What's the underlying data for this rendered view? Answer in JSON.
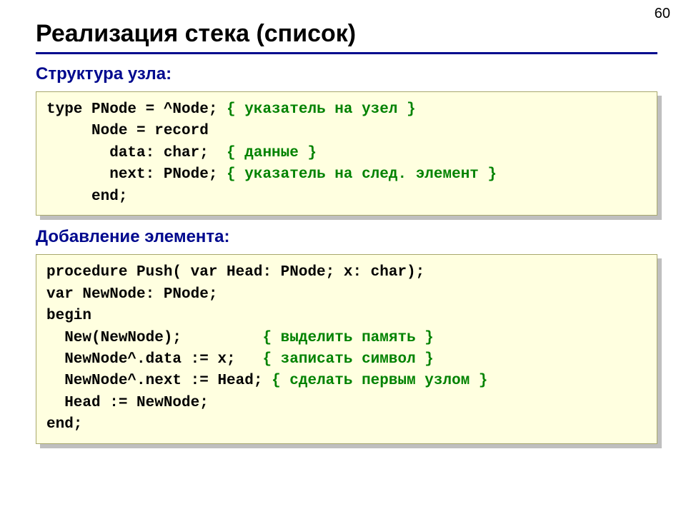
{
  "pageNumber": "60",
  "title": "Реализация стека (список)",
  "section1": "Структура узла:",
  "section2": "Добавление элемента:",
  "c1_l1a": "type PNode = ^Node; ",
  "c1_l1b": "{ указатель на узел }",
  "c1_l2": "     Node = record",
  "c1_l3a": "       data: char;  ",
  "c1_l3b": "{ данные }",
  "c1_l4a": "       next: PNode; ",
  "c1_l4b": "{ указатель на след. элемент }",
  "c1_l5": "     end;",
  "c2_l1": "procedure Push( var Head: PNode; x: char);",
  "c2_l2": "var NewNode: PNode;",
  "c2_l3": "begin",
  "c2_l4a": "  New(NewNode);         ",
  "c2_l4b": "{ выделить память }",
  "c2_l5a": "  NewNode^.data := x;   ",
  "c2_l5b": "{ записать символ }",
  "c2_l6a": "  NewNode^.next := Head; ",
  "c2_l6b": "{ сделать первым узлом }",
  "c2_l7": "  Head := NewNode;",
  "c2_l8": "end;"
}
